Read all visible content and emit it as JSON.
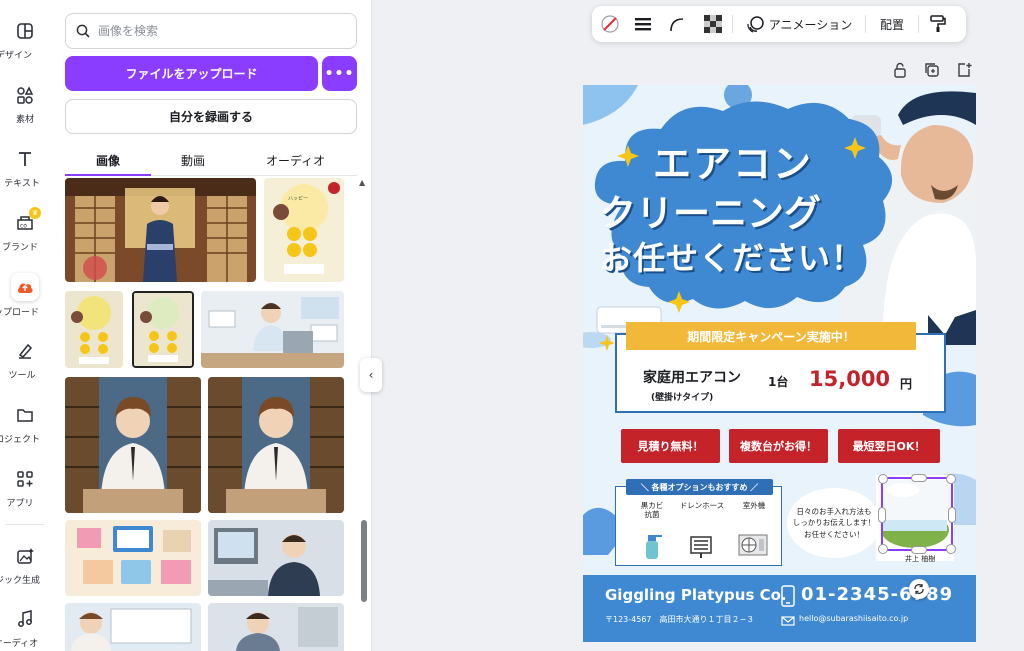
{
  "rail": {
    "items": [
      {
        "label": "デザイン"
      },
      {
        "label": "素材"
      },
      {
        "label": "テキスト"
      },
      {
        "label": "ブランド"
      },
      {
        "label": "アップロード"
      },
      {
        "label": "ツール"
      },
      {
        "label": "プロジェクト"
      },
      {
        "label": "アプリ"
      },
      {
        "label": "マジック生成"
      },
      {
        "label": "オーディオ"
      }
    ],
    "crown_glyph": "♛"
  },
  "panel": {
    "search_placeholder": "画像を検索",
    "upload_label": "ファイルをアップロード",
    "more_label": "•••",
    "record_label": "自分を録画する",
    "tabs": [
      {
        "label": "画像",
        "active": true
      },
      {
        "label": "動画",
        "active": false
      },
      {
        "label": "オーディオ",
        "active": false
      }
    ],
    "collapse_glyph": "‹",
    "scroll_up_glyph": "▲"
  },
  "toolbar": {
    "animate_label": "アニメーション",
    "position_label": "配置"
  },
  "flyer": {
    "headline": [
      "エアコン",
      "クリーニング",
      "お任せください！"
    ],
    "banner": "期間限定キャンペーン実施中！",
    "product": "家庭用エアコン",
    "product_sub": "(壁掛けタイプ)",
    "unit": "1台",
    "price": "15,000",
    "currency": "円",
    "buttons": [
      "見積り無料！",
      "複数台がお得！",
      "最短翌日OK！"
    ],
    "options_title": "＼ 各種オプションもおすすめ ／",
    "options": [
      "黒カビ\n抗菌",
      "ドレンホース",
      "室外機"
    ],
    "bubble": "日々のお手入れ方法も\nしっかりお伝えします！\nお任せください！",
    "staff_name": "井上 柚樹",
    "company": "Giggling Platypus Co.",
    "phone": "01-2345-6789",
    "address": "〒123-4567　高田市大通り１丁目２−３",
    "email": "hello@subarashiisaito.co.jp"
  },
  "colors": {
    "accent": "#8b3dff",
    "flyer_blue": "#3f88d2",
    "flyer_red": "#c4232a",
    "flyer_gold": "#f2b83a",
    "price_red": "#c4232a"
  }
}
